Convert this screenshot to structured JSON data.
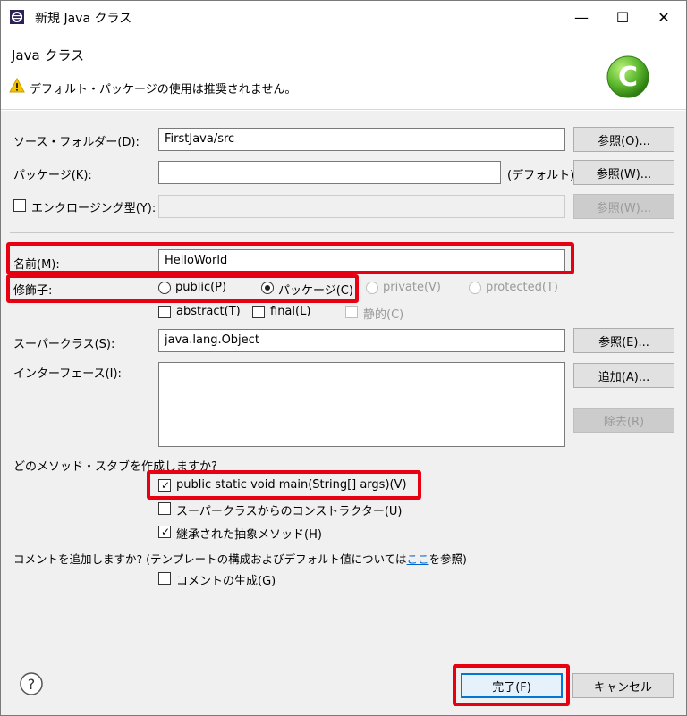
{
  "window": {
    "title": "新規 Java クラス",
    "minimize_glyph": "—",
    "maximize_glyph": "☐",
    "close_glyph": "✕"
  },
  "header": {
    "title": "Java クラス",
    "message": "デフォルト・パッケージの使用は推奨されません。",
    "logo_letter": "C"
  },
  "form": {
    "source_folder": {
      "label": "ソース・フォルダー(D):",
      "value": "FirstJava/src",
      "button": "参照(O)..."
    },
    "package": {
      "label": "パッケージ(K):",
      "value": "",
      "suffix": "(デフォルト)",
      "button": "参照(W)..."
    },
    "enclosing": {
      "label": "エンクロージング型(Y):",
      "value": "",
      "button": "参照(W)...",
      "checked": false
    },
    "name": {
      "label": "名前(M):",
      "value": "HelloWorld"
    },
    "modifiers": {
      "label": "修飾子:",
      "public": "public(P)",
      "package": "パッケージ(C)",
      "private": "private(V)",
      "protected": "protected(T)",
      "abstract": "abstract(T)",
      "final": "final(L)",
      "static": "静的(C)"
    },
    "superclass": {
      "label": "スーパークラス(S):",
      "value": "java.lang.Object",
      "button": "参照(E)..."
    },
    "interfaces": {
      "label": "インターフェース(I):",
      "add_button": "追加(A)...",
      "remove_button": "除去(R)"
    },
    "stubs": {
      "question": "どのメソッド・スタブを作成しますか?",
      "main": "public static void main(String[] args)(V)",
      "constructors": "スーパークラスからのコンストラクター(U)",
      "inherited": "継承された抽象メソッド(H)"
    },
    "comments": {
      "question_before": "コメントを追加しますか? (テンプレートの構成およびデフォルト値については",
      "link": "ここ",
      "question_after": "を参照)",
      "generate": "コメントの生成(G)"
    }
  },
  "footer": {
    "help_glyph": "?",
    "finish_button": "完了(F)",
    "cancel_button": "キャンセル"
  },
  "colors": {
    "highlight": "#e60012",
    "accent": "#0078d7",
    "logo_green": "#5cb82e"
  }
}
